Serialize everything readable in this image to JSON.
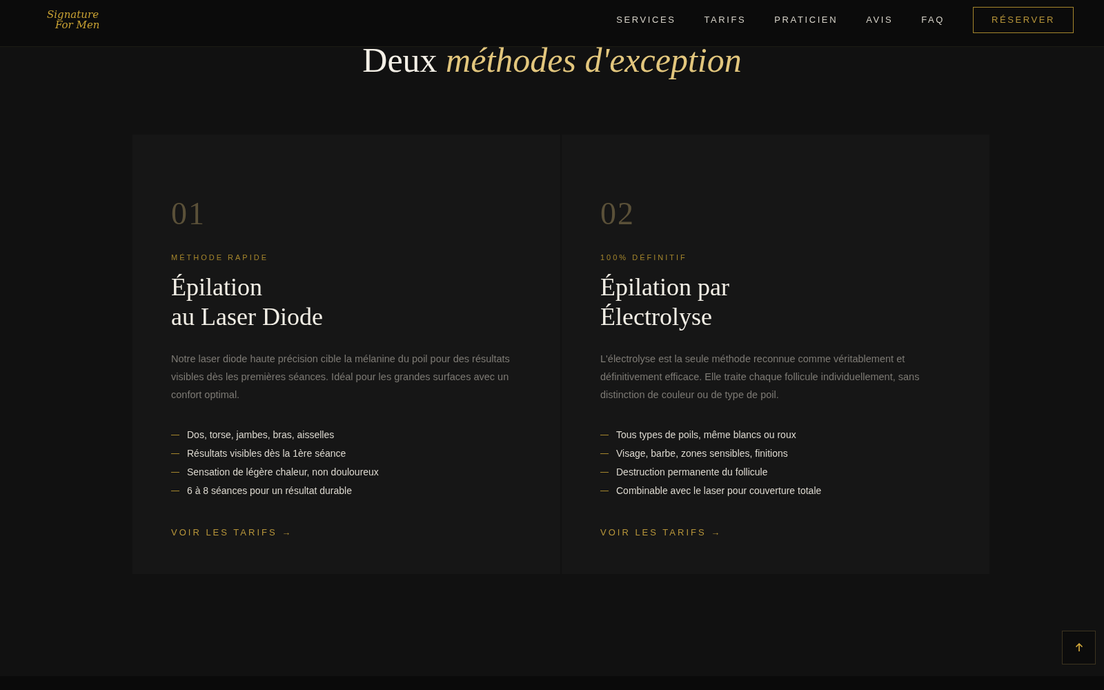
{
  "header": {
    "logo_line_1": "Signature",
    "logo_line_2": "For Men",
    "nav": [
      "SERVICES",
      "TARIFS",
      "PRATICIEN",
      "AVIS",
      "FAQ"
    ],
    "cta": "RÉSERVER"
  },
  "section": {
    "heading_plain": "Deux",
    "heading_accent": "méthodes d'exception"
  },
  "cards": [
    {
      "number": "01",
      "eyebrow": "MÉTHODE RAPIDE",
      "title_lines": [
        "Épilation",
        "au Laser Diode"
      ],
      "description": "Notre laser diode haute précision cible la mélanine du poil pour des résultats visibles dès les premières séances. Idéal pour les grandes surfaces avec un confort optimal.",
      "features": [
        "Dos, torse, jambes, bras, aisselles",
        "Résultats visibles dès la 1ère séance",
        "Sensation de légère chaleur, non douloureux",
        "6 à 8 séances pour un résultat durable"
      ],
      "link": "VOIR LES TARIFS →"
    },
    {
      "number": "02",
      "eyebrow": "100% DÉFINITIF",
      "title_lines": [
        "Épilation par",
        "Électrolyse"
      ],
      "description": "L'électrolyse est la seule méthode reconnue comme véritablement et définitivement efficace. Elle traite chaque follicule individuellement, sans distinction de couleur ou de type de poil.",
      "features": [
        "Tous types de poils, même blancs ou roux",
        "Visage, barbe, zones sensibles, finitions",
        "Destruction permanente du follicule",
        "Combinable avec le laser pour couverture totale"
      ],
      "link": "VOIR LES TARIFS →"
    }
  ]
}
